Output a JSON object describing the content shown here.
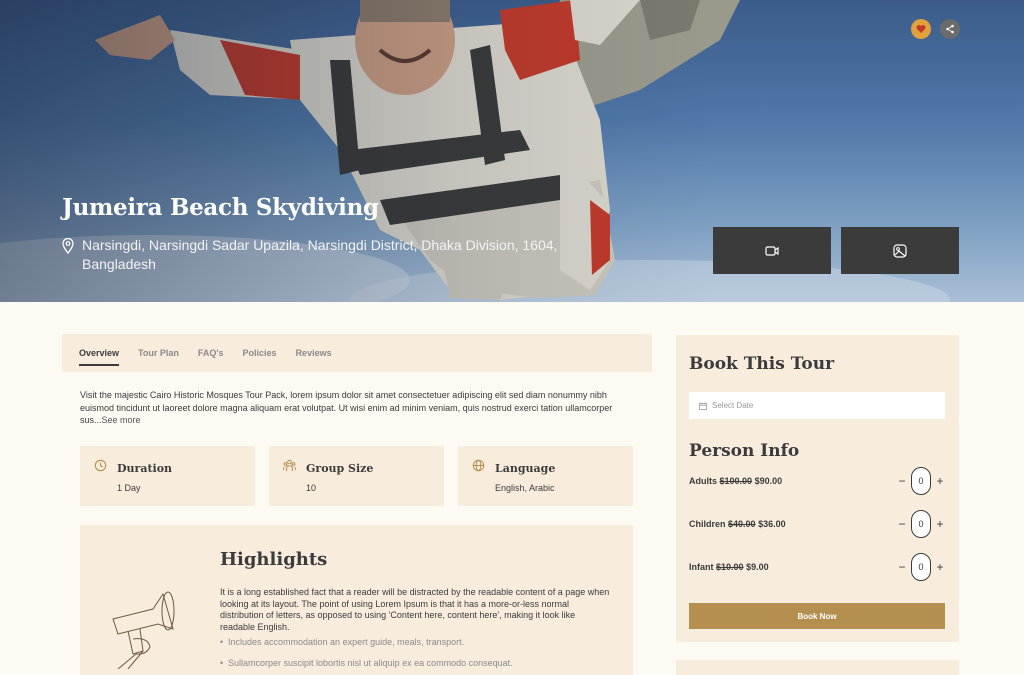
{
  "hero": {
    "title": "Jumeira Beach Skydiving",
    "location": "Narsingdi, Narsingdi Sadar Upazila, Narsingdi District, Dhaka Division, 1604, Bangladesh",
    "icons": [
      "location-pin-icon",
      "video-icon",
      "gallery-icon",
      "heart-icon",
      "share-icon"
    ],
    "favorite_color": "#e0a23a"
  },
  "tabs": [
    "Overview",
    "Tour Plan",
    "FAQ's",
    "Policies",
    "Reviews"
  ],
  "overview": {
    "text": "Visit the majestic Cairo Historic Mosques Tour Pack, lorem ipsum dolor sit amet consectetuer adipiscing elit sed diam nonummy nibh euismod tincidunt ut laoreet dolore magna aliquam erat volutpat. Ut wisi enim ad minim veniam, quis nostrud exerci tation ullamcorper sus...",
    "see_more": "See more"
  },
  "info": [
    {
      "title": "Duration",
      "value": "1 Day",
      "icon": "clock-icon"
    },
    {
      "title": "Group Size",
      "value": "10",
      "icon": "group-icon"
    },
    {
      "title": "Language",
      "value": "English, Arabic",
      "icon": "globe-icon"
    }
  ],
  "highlights": {
    "title": "Highlights",
    "text": "It is a long established fact that a reader will be distracted by the readable content of a page when looking at its layout. The point of using Lorem Ipsum is that it has a more-or-less normal distribution of letters, as opposed to using 'Content here, content here', making it look like readable English.",
    "items": [
      "Includes accommodation an expert guide, meals, transport.",
      "Sullamcorper suscipit lobortis nisl ut aliquip ex ea commodo consequat."
    ]
  },
  "booking": {
    "title": "Book This Tour",
    "date_placeholder": "Select Date",
    "person_title": "Person Info",
    "rows": [
      {
        "label": "Adults",
        "old": "$100.00",
        "price": "$90.00",
        "qty": "0"
      },
      {
        "label": "Children",
        "old": "$40.00",
        "price": "$36.00",
        "qty": "0"
      },
      {
        "label": "Infant",
        "old": "$10.00",
        "price": "$9.00",
        "qty": "0"
      }
    ],
    "button": "Book Now",
    "accent": "#b58f4f"
  }
}
